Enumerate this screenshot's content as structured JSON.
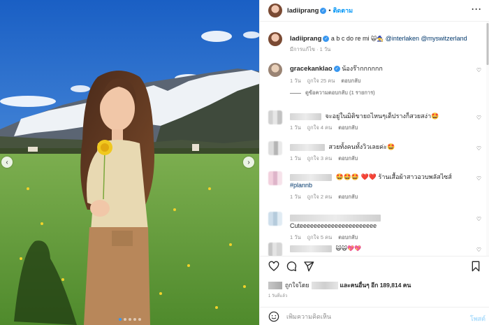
{
  "post": {
    "username": "ladiiprang",
    "follow_label": "ติดตาม",
    "more_label": "···",
    "caption": "a b c do re mi",
    "caption_emoji": "🙀🧙",
    "mentions": [
      "@interlaken",
      "@myswitzerland"
    ],
    "caption_meta": "มีการแก้ไข · 1 วัน"
  },
  "comments": [
    {
      "username": "gracekanklao",
      "text": "น้องร๊ากกกกกก",
      "time": "1 วัน",
      "likes": "ถูกใจ 25 คน",
      "reply_label": "ตอบกลับ",
      "view_replies": "ดูข้อความตอบกลับ (1 รายการ)"
    },
    {
      "text": "จะอยู่ในมิติขายถไหนๆเด็ปรางก็สวยสง่า🤩",
      "time": "1 วัน",
      "likes": "ถูกใจ 4 คน",
      "reply_label": "ตอบกลับ"
    },
    {
      "text": "สวยทั้งคนทั้งวิวเลยค่ะ🤩",
      "time": "1 วัน",
      "likes": "ถูกใจ 3 คน",
      "reply_label": "ตอบกลับ"
    },
    {
      "text": "🤩🤩🤩 ❤️❤️ ร้านเสื้อผ้าสาวอวบพลัสไซส์",
      "hashtag": "#plannb",
      "time": "1 วัน",
      "likes": "ถูกใจ 2 คน",
      "reply_label": "ตอบกลับ"
    },
    {
      "text": "Cuteeeeeeeeeeeeeeeeeeeeee",
      "time": "1 วัน",
      "likes": "ถูกใจ 5 คน",
      "reply_label": "ตอบกลับ"
    },
    {
      "text": "🙀🙀💖💖"
    }
  ],
  "footer": {
    "likes_prefix": "ถูกใจโดย",
    "likes_suffix": "และคนอื่นๆ อีก 189,814 คน",
    "timestamp": "1 วันที่แล้ว",
    "add_comment_placeholder": "เพิ่มความคิดเห็น",
    "post_label": "โพสต์"
  },
  "icons": {
    "like": "heart-icon",
    "comment": "comment-icon",
    "share": "share-icon",
    "save": "bookmark-icon",
    "emoji": "smile-icon",
    "carousel_prev": "chevron-left-icon",
    "carousel_next": "chevron-right-icon"
  },
  "colors": {
    "link": "#00376b",
    "follow": "#0095f6",
    "muted": "#8e8e8e",
    "verified": "#3897f0"
  },
  "carousel": {
    "total": 5,
    "current": 1
  }
}
